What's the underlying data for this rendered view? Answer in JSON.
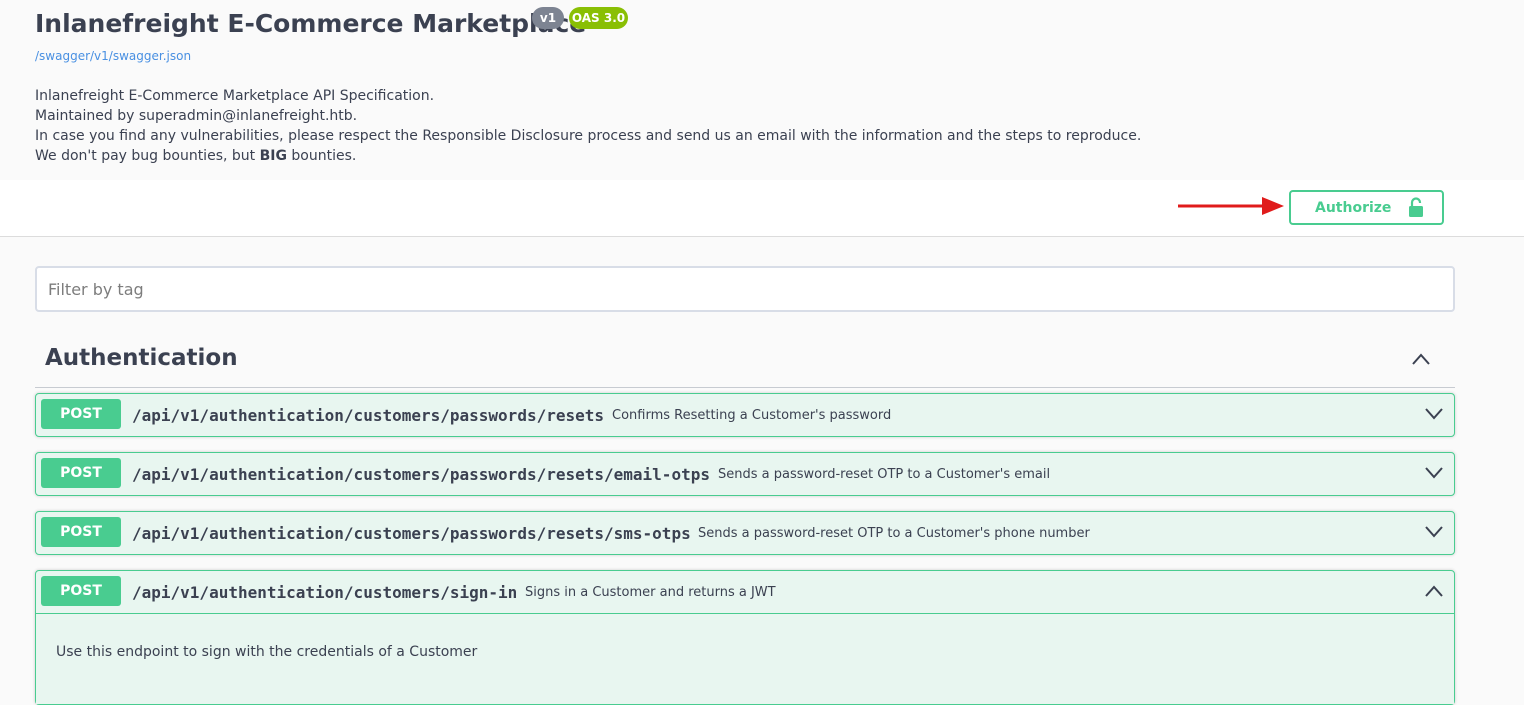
{
  "info": {
    "title": "Inlanefreight E-Commerce Marketplace",
    "version_badge": "v1",
    "oas_badge": "OAS 3.0",
    "spec_url": "/swagger/v1/swagger.json",
    "description": {
      "line1": "Inlanefreight E-Commerce Marketplace API Specification.",
      "line2": "Maintained by superadmin@inlanefreight.htb.",
      "line3": "In case you find any vulnerabilities, please respect the Responsible Disclosure process and send us an email with the information and the steps to reproduce.",
      "line4_before": "We don't pay bug bounties, but",
      "line4_bold": "BIG",
      "line4_after": "bounties."
    }
  },
  "authorize": {
    "label": "Authorize"
  },
  "filter": {
    "placeholder": "Filter by tag",
    "value": ""
  },
  "tag": {
    "name": "Authentication"
  },
  "operations": [
    {
      "method": "POST",
      "path": "/api/v1/authentication/customers/passwords/resets",
      "summary": "Confirms Resetting a Customer's password",
      "expanded": false
    },
    {
      "method": "POST",
      "path": "/api/v1/authentication/customers/passwords/resets/email-otps",
      "summary": "Sends a password-reset OTP to a Customer's email",
      "expanded": false
    },
    {
      "method": "POST",
      "path": "/api/v1/authentication/customers/passwords/resets/sms-otps",
      "summary": "Sends a password-reset OTP to a Customer's phone number",
      "expanded": false
    },
    {
      "method": "POST",
      "path": "/api/v1/authentication/customers/sign-in",
      "summary": "Signs in a Customer and returns a JWT",
      "expanded": true,
      "description": "Use this endpoint to sign with the credentials of a Customer"
    }
  ],
  "colors": {
    "post": "#49cc90",
    "post_bg": "#e8f6f0",
    "text": "#3b4151",
    "link": "#4990e2",
    "version_badge": "#7d8492",
    "oas_badge": "#89bf04",
    "arrow": "#e01b1b"
  },
  "icons": [
    "unlock-icon",
    "chevron-up-icon",
    "chevron-down-icon",
    "red-arrow-annotation"
  ]
}
